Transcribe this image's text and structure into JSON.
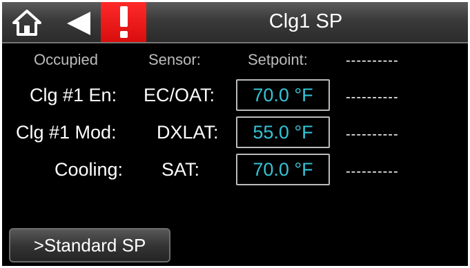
{
  "header": {
    "home_icon": "home-icon",
    "back_icon": "back-arrow-icon",
    "alarm_icon": "exclamation-icon",
    "alarm_color": "#e01212",
    "title": "Clg1 SP"
  },
  "columns": {
    "status": "Occupied",
    "sensor": "Sensor:",
    "setpoint": "Setpoint:",
    "extra": "----------"
  },
  "rows": [
    {
      "label": "Clg #1 En:",
      "sensor": "EC/OAT:",
      "value": "70.0 °F",
      "extra": "----------"
    },
    {
      "label": "Clg #1 Mod:",
      "sensor": "DXLAT:",
      "value": "55.0 °F",
      "extra": "----------"
    },
    {
      "label": "Cooling:",
      "sensor": "SAT:",
      "value": "70.0 °F",
      "extra": "----------"
    }
  ],
  "footer": {
    "standard_sp_label": ">Standard SP"
  },
  "colors": {
    "value_text": "#34c3d6",
    "background": "#000000"
  }
}
